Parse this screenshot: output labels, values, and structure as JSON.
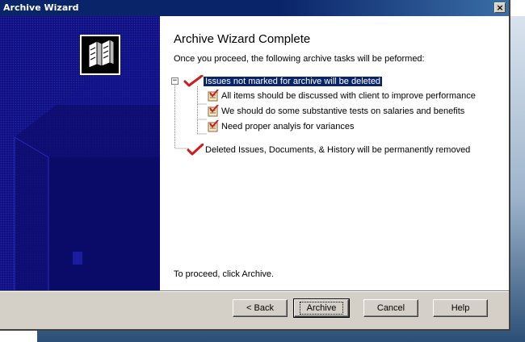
{
  "window": {
    "title": "Archive Wizard",
    "close_label": "×"
  },
  "content": {
    "heading": "Archive Wizard Complete",
    "subtitle": "Once you proceed, the following archive tasks will be peformed:",
    "tree": {
      "expander_symbol": "−",
      "root_selected": "Issues not marked for archive will be deleted",
      "children": [
        "All items should be discussed with client to improve performance",
        "We should do some substantive tests on salaries and benefits",
        "Need proper analyis for variances"
      ],
      "second_root": "Deleted Issues, Documents, & History will be permanently removed"
    },
    "proceed_text": "To proceed, click Archive."
  },
  "buttons": {
    "back": "< Back",
    "archive": "Archive",
    "cancel": "Cancel",
    "help": "Help"
  },
  "colors": {
    "titlebar": "#0a246a",
    "sidebar": "#101080",
    "selection": "#0a246a",
    "checkmark": "#d11a1a",
    "dialog_face": "#d4d0c8"
  },
  "icons": {
    "wizard_logo": "archive-cabinets-icon",
    "root_item": "red-checkmark-icon",
    "child_item": "note-check-icon"
  }
}
